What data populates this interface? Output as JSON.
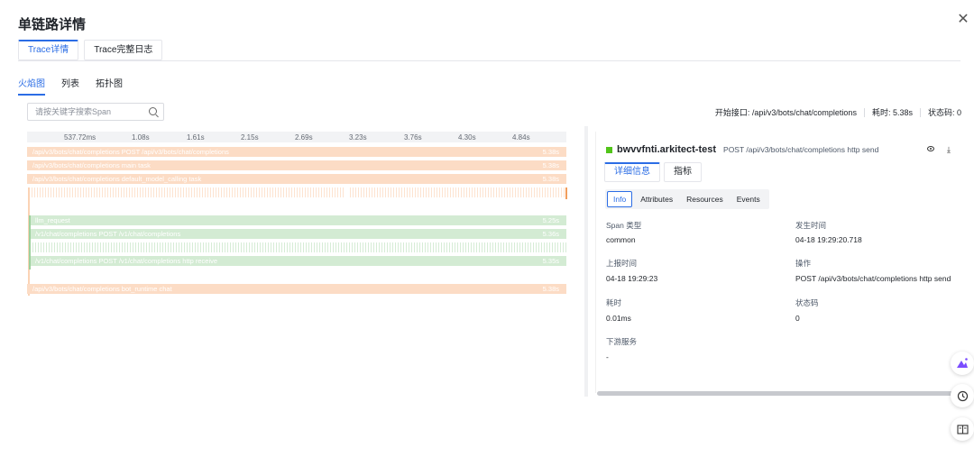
{
  "title": "单链路详情",
  "top_tabs": [
    {
      "label": "Trace详情",
      "active": true
    },
    {
      "label": "Trace完整日志",
      "active": false
    }
  ],
  "view_tabs": [
    {
      "label": "火焰图",
      "active": true
    },
    {
      "label": "列表",
      "active": false
    },
    {
      "label": "拓扑图",
      "active": false
    }
  ],
  "search": {
    "placeholder": "请按关键字搜索Span",
    "value": ""
  },
  "summary": {
    "start_api": "开始接口: /api/v3/bots/chat/completions",
    "duration": "耗时: 5.38s",
    "status": "状态码: 0"
  },
  "flame": {
    "ticks": [
      "537.72ms",
      "1.08s",
      "1.61s",
      "2.15s",
      "2.69s",
      "3.23s",
      "3.76s",
      "4.30s",
      "4.84s"
    ],
    "bars": [
      {
        "label": "/api/v3/bots/chat/completions POST /api/v3/bots/chat/completions",
        "duration": "5.38s",
        "color": "#fcdcc5"
      },
      {
        "label": "/api/v3/bots/chat/completions main task",
        "duration": "5.38s",
        "color": "#fcdcc5"
      },
      {
        "label": "/api/v3/bots/chat/completions default_model_calling task",
        "duration": "5.38s",
        "color": "#fcdcc5"
      },
      {
        "label": "llm_request",
        "duration": "5.25s",
        "color": "#d3ebd3"
      },
      {
        "label": "/v1/chat/completions POST /v1/chat/completions",
        "duration": "5.36s",
        "color": "#d3ebd3"
      },
      {
        "label": "/v1/chat/completions POST /v1/chat/completions http receive",
        "duration": "5.35s",
        "color": "#d3ebd3"
      },
      {
        "label": "/api/v3/bots/chat/completions bot_runtime chat",
        "duration": "5.38s",
        "color": "#fcdcc5"
      }
    ]
  },
  "panel": {
    "service": "bwvvfnti.arkitect-test",
    "operation": "POST /api/v3/bots/chat/completions http send",
    "tabs": [
      {
        "label": "详细信息",
        "active": true
      },
      {
        "label": "指标",
        "active": false
      }
    ],
    "subtabs": [
      {
        "label": "Info",
        "active": true
      },
      {
        "label": "Attributes",
        "active": false
      },
      {
        "label": "Resources",
        "active": false
      },
      {
        "label": "Events",
        "active": false
      }
    ],
    "fields": {
      "span_type_label": "Span 类型",
      "span_type_value": "common",
      "occur_time_label": "发生时间",
      "occur_time_value": "04-18 19:29:20.718",
      "report_time_label": "上报时间",
      "report_time_value": "04-18 19:29:23",
      "operation_label": "操作",
      "operation_value": "POST /api/v3/bots/chat/completions http send",
      "duration_label": "耗时",
      "duration_value": "0.01ms",
      "status_label": "状态码",
      "status_value": "0",
      "downstream_label": "下游服务",
      "downstream_value": "-"
    }
  },
  "colors": {
    "accent": "#2b6de5",
    "orange": "#fcdcc5",
    "green": "#d3ebd3",
    "service_dot": "#52c41a"
  },
  "icons": [
    "close-icon",
    "search-icon",
    "eye-icon",
    "download-icon",
    "ai-assistant-icon",
    "history-icon",
    "book-icon"
  ]
}
